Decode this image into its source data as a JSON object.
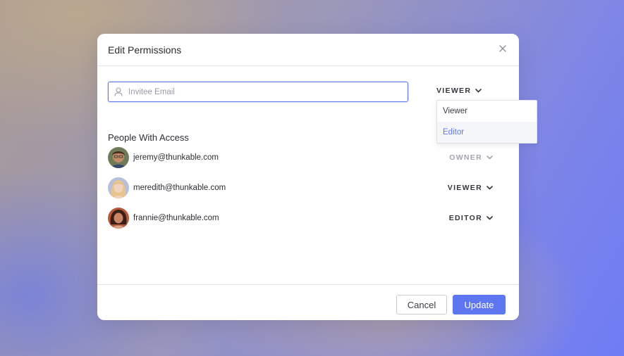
{
  "modal": {
    "title": "Edit Permissions",
    "close_icon": "close-icon"
  },
  "invite": {
    "placeholder": "Invitee Email",
    "value": "",
    "icon": "user-icon",
    "role_label": "VIEWER",
    "role_icon": "chevron-down-icon"
  },
  "role_dropdown": {
    "options": [
      {
        "label": "Viewer",
        "highlighted": false
      },
      {
        "label": "Editor",
        "highlighted": true
      }
    ]
  },
  "access": {
    "title": "People With Access",
    "people": [
      {
        "email": "jeremy@thunkable.com",
        "role": "OWNER",
        "role_editable": false,
        "avatar": "avatar-jeremy"
      },
      {
        "email": "meredith@thunkable.com",
        "role": "VIEWER",
        "role_editable": true,
        "avatar": "avatar-meredith"
      },
      {
        "email": "frannie@thunkable.com",
        "role": "EDITOR",
        "role_editable": true,
        "avatar": "avatar-frannie"
      }
    ]
  },
  "footer": {
    "cancel_label": "Cancel",
    "update_label": "Update"
  },
  "colors": {
    "accent": "#5E76F0",
    "text": "#2C2D33",
    "muted": "#A2A4AE"
  }
}
